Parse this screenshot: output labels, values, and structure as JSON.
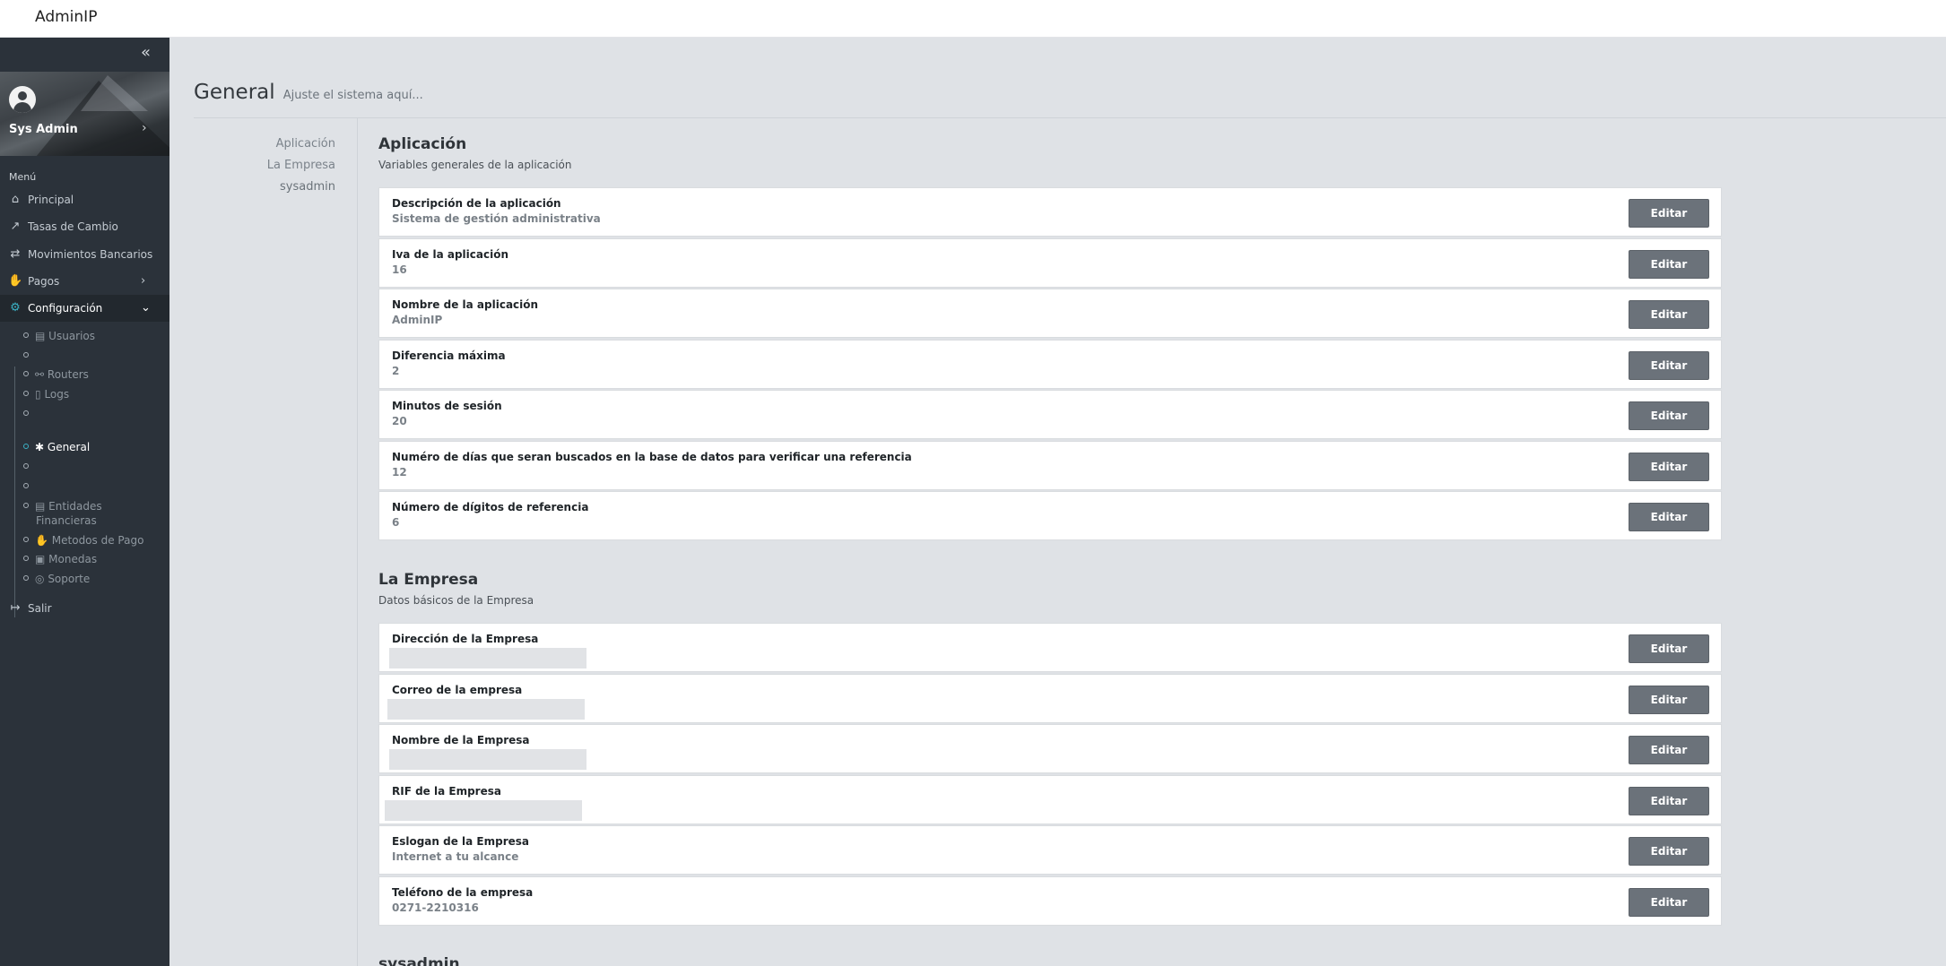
{
  "app": {
    "title": "AdminIP"
  },
  "sidebar": {
    "user_name": "Sys Admin",
    "menu_title": "Menú",
    "items": [
      {
        "label": "Principal",
        "icon": "home-icon"
      },
      {
        "label": "Tasas de Cambio",
        "icon": "chart-line-icon"
      },
      {
        "label": "Movimientos Bancarios",
        "icon": "exchange-icon"
      },
      {
        "label": "Pagos",
        "icon": "hand-holding-dollar-icon"
      },
      {
        "label": "Configuración",
        "icon": "gears-icon"
      },
      {
        "label": "Salir",
        "icon": "sign-out-icon"
      }
    ],
    "sub_items": [
      {
        "label": "Usuarios",
        "icon": "id-card-icon"
      },
      {
        "label": "",
        "icon": ""
      },
      {
        "label": "Routers",
        "icon": "sitemap-icon"
      },
      {
        "label": "Logs",
        "icon": "file-icon"
      },
      {
        "label": "",
        "icon": ""
      },
      {
        "label": "General",
        "icon": "gear-icon"
      },
      {
        "label": "",
        "icon": ""
      },
      {
        "label": "",
        "icon": ""
      },
      {
        "label": "Entidades",
        "label2": "Financieras",
        "icon": "id-card-icon"
      },
      {
        "label": "Metodos de Pago",
        "icon": "hand-holding-dollar-icon"
      },
      {
        "label": "Monedas",
        "icon": "money-bill-icon"
      },
      {
        "label": "Soporte",
        "icon": "life-ring-icon"
      }
    ]
  },
  "page": {
    "title": "General",
    "subtitle": "Ajuste el sistema aquí...",
    "section_nav": [
      "Aplicación",
      "La Empresa",
      "sysadmin"
    ]
  },
  "sections": {
    "app": {
      "title": "Aplicación",
      "description": "Variables generales de la aplicación",
      "settings": [
        {
          "label": "Descripción de la aplicación",
          "value": "Sistema de gestión administrativa"
        },
        {
          "label": "Iva de la aplicación",
          "value": "16"
        },
        {
          "label": "Nombre de la aplicación",
          "value": "AdminIP"
        },
        {
          "label": "Diferencia máxima",
          "value": "2"
        },
        {
          "label": "Minutos de sesión",
          "value": "20"
        },
        {
          "label": "Numéro de días que seran buscados en la base de datos para verificar una referencia",
          "value": "12"
        },
        {
          "label": "Número de dígitos de referencia",
          "value": "6"
        }
      ]
    },
    "company": {
      "title": "La Empresa",
      "description": "Datos básicos de la Empresa",
      "settings": [
        {
          "label": "Dirección de la Empresa",
          "value": ""
        },
        {
          "label": "Correo de la empresa",
          "value": ""
        },
        {
          "label": "Nombre de la Empresa",
          "value": ""
        },
        {
          "label": "RIF de la Empresa",
          "value": ""
        },
        {
          "label": "Eslogan de la Empresa",
          "value": "Internet a tu alcance"
        },
        {
          "label": "Teléfono de la empresa",
          "value": "0271-2210316"
        }
      ]
    },
    "sysadmin": {
      "title": "sysadmin"
    }
  },
  "buttons": {
    "edit_label": "Editar"
  },
  "colors": {
    "sidebar_bg": "#2b323a",
    "accent": "#3bb2c6",
    "edit_button_bg": "#6b727a",
    "page_bg": "#dfe2e6"
  }
}
